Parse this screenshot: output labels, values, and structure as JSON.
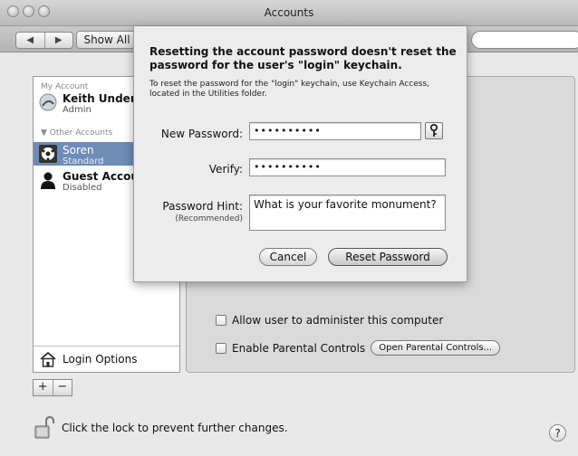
{
  "window": {
    "title": "Accounts"
  },
  "toolbar": {
    "back": "◀",
    "forward": "▶",
    "show_all": "Show All"
  },
  "sidebar": {
    "section_my": "My Account",
    "my_user": {
      "name": "Keith Underc",
      "role": "Admin"
    },
    "section_other": "▼ Other Accounts",
    "users": [
      {
        "name": "Soren",
        "role": "Standard"
      },
      {
        "name": "Guest Accou",
        "role": "Disabled"
      }
    ],
    "login_options": "Login Options"
  },
  "list_controls": {
    "add": "+",
    "remove": "−"
  },
  "panel": {
    "allow_admin": "Allow user to administer this computer",
    "parental_controls": "Enable Parental Controls",
    "open_parental_controls": "Open Parental Controls..."
  },
  "lock": {
    "text": "Click the lock to prevent further changes."
  },
  "help": "?",
  "sheet": {
    "title": "Resetting the account password doesn't reset the password for the user's \"login\" keychain.",
    "info": "To reset the password for the \"login\" keychain, use Keychain Access, located in the Utilities folder.",
    "new_password_label": "New Password:",
    "new_password_value": "••••••••••",
    "verify_label": "Verify:",
    "verify_value": "••••••••••",
    "hint_label": "Password Hint:",
    "hint_sub": "(Recommended)",
    "hint_value": "What is your favorite monument?",
    "cancel": "Cancel",
    "reset": "Reset Password"
  },
  "colors": {
    "selection": "#6e8cb8",
    "window_bg": "#e8e8e8"
  }
}
